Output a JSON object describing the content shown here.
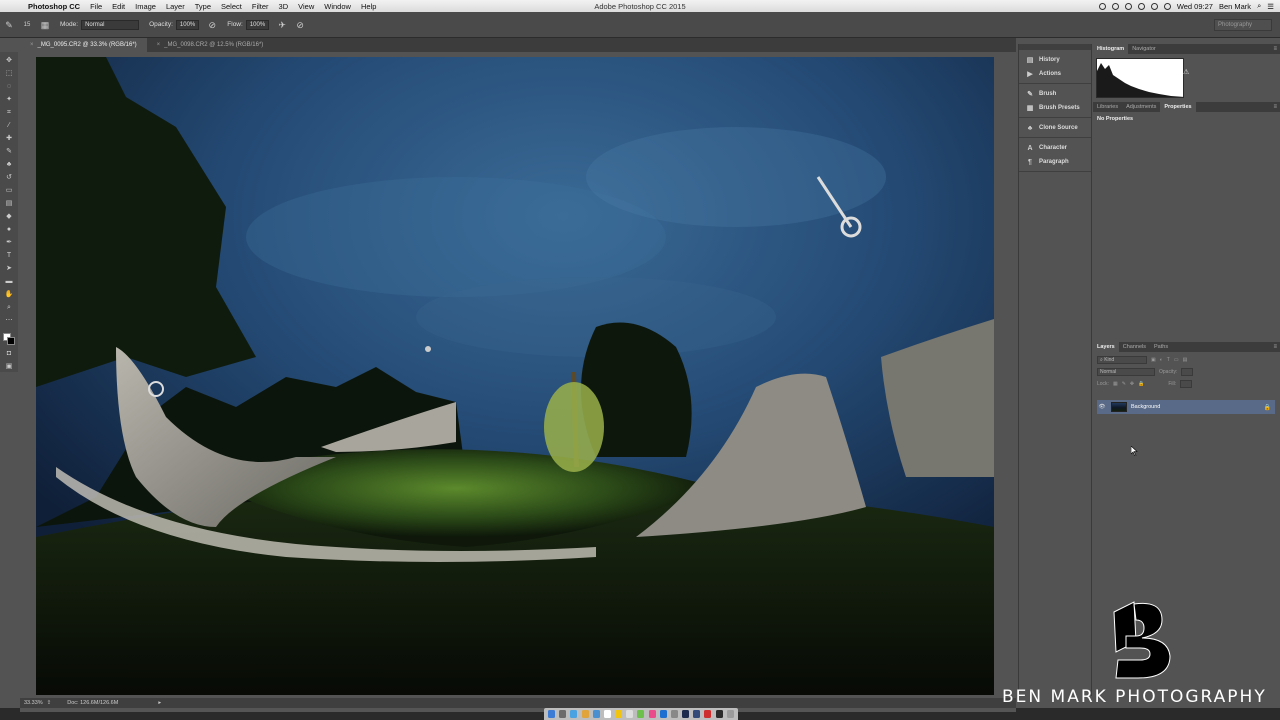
{
  "menubar": {
    "app_name": "Photoshop CC",
    "items": [
      "File",
      "Edit",
      "Image",
      "Layer",
      "Type",
      "Select",
      "Filter",
      "3D",
      "View",
      "Window",
      "Help"
    ],
    "window_title": "Adobe Photoshop CC 2015",
    "clock": "Wed 09:27",
    "user": "Ben Mark"
  },
  "options": {
    "brush_size": "15",
    "mode_label": "Mode:",
    "mode_value": "Normal",
    "opacity_label": "Opacity:",
    "opacity_value": "100%",
    "flow_label": "Flow:",
    "flow_value": "100%",
    "workspace": "Photography"
  },
  "tabs": [
    {
      "label": "_MG_0095.CR2 @ 33.3% (RGB/16*)",
      "active": true
    },
    {
      "label": "_MG_0098.CR2 @ 12.5% (RGB/16*)",
      "active": false
    }
  ],
  "status": {
    "zoom": "33.33%",
    "doc": "Doc: 126.6M/126.6M"
  },
  "collapsed_panels": {
    "history": "History",
    "actions": "Actions",
    "brush": "Brush",
    "brush_presets": "Brush Presets",
    "clone_source": "Clone Source",
    "character": "Character",
    "paragraph": "Paragraph"
  },
  "panels": {
    "top_tabs": [
      "Histogram",
      "Navigator"
    ],
    "mid_tabs": [
      "Libraries",
      "Adjustments",
      "Properties"
    ],
    "properties_text": "No Properties",
    "layer_tabs": [
      "Layers",
      "Channels",
      "Paths"
    ],
    "kind_label": "Kind",
    "blend_mode": "Normal",
    "opacity_label": "Opacity:",
    "lock_label": "Lock:",
    "fill_label": "Fill:",
    "layer_name": "Background"
  },
  "watermark": {
    "text": "BEN MARK PHOTOGRAPHY"
  }
}
